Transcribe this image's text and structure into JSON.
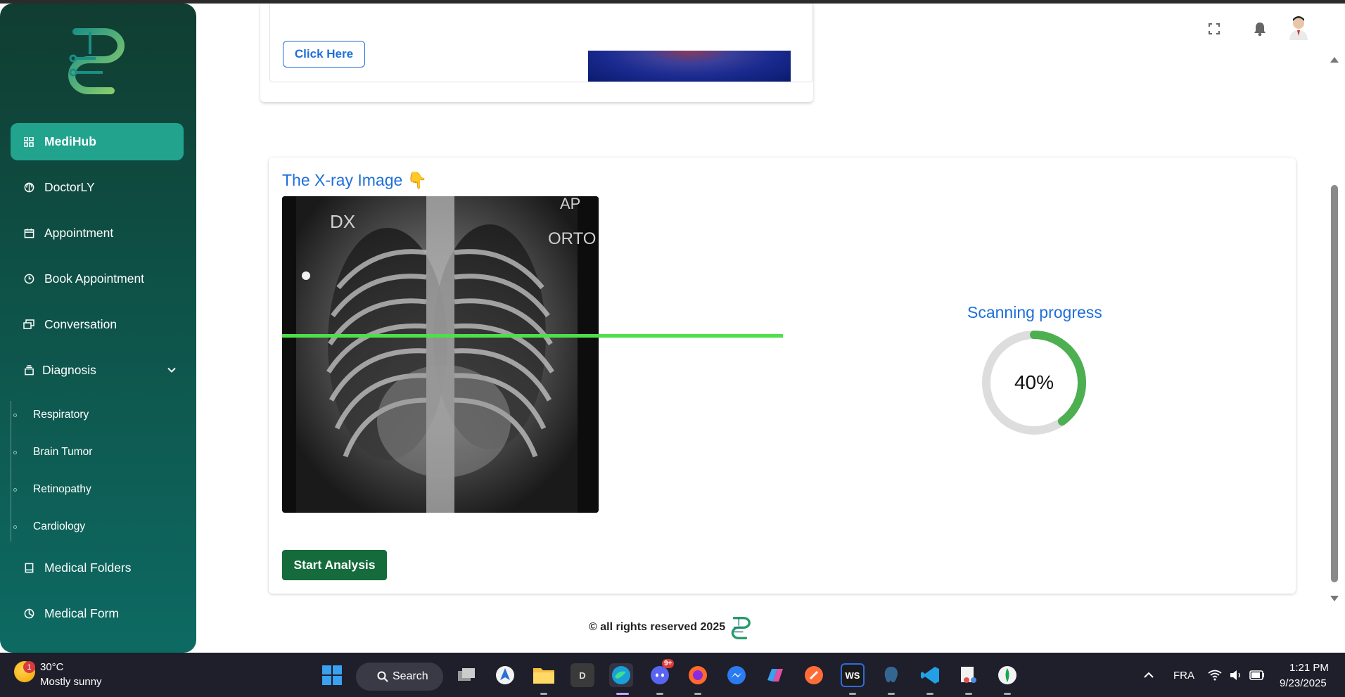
{
  "sidebar": {
    "items": [
      {
        "label": "MediHub",
        "icon": "grid-icon",
        "active": true
      },
      {
        "label": "DoctorLY",
        "icon": "globe-icon"
      },
      {
        "label": "Appointment",
        "icon": "calendar-icon"
      },
      {
        "label": "Book Appointment",
        "icon": "clock-icon"
      },
      {
        "label": "Conversation",
        "icon": "chat-icon"
      },
      {
        "label": "Diagnosis",
        "icon": "stack-icon"
      },
      {
        "label": "Medical Folders",
        "icon": "book-icon"
      },
      {
        "label": "Medical Form",
        "icon": "pie-icon"
      }
    ],
    "diagnosis_sub": [
      "Respiratory",
      "Brain Tumor",
      "Retinopathy",
      "Cardiology"
    ]
  },
  "top_card": {
    "button_label": "Click Here"
  },
  "main": {
    "xray_title": "The X-ray Image 👇",
    "xray_labels": {
      "left": "DX",
      "right_top": "AP",
      "right": "ORTO"
    },
    "scan_title": "Scanning progress",
    "progress_percent": 40,
    "progress_label": "40%",
    "start_button": "Start Analysis"
  },
  "footer": {
    "text": "© all rights reserved 2025"
  },
  "colors": {
    "accent": "#21a38e",
    "link": "#1e6fd9",
    "progress": "#4caf50",
    "scanline": "#4ee04a",
    "start": "#156b3c"
  },
  "taskbar": {
    "weather_temp": "30°C",
    "weather_desc": "Mostly sunny",
    "weather_badge": "1",
    "search_label": "Search",
    "language": "FRA",
    "time": "1:21 PM",
    "date": "9/23/2025",
    "discord_badge": "9+",
    "d_app_label": "D",
    "ws_label": "WS"
  }
}
